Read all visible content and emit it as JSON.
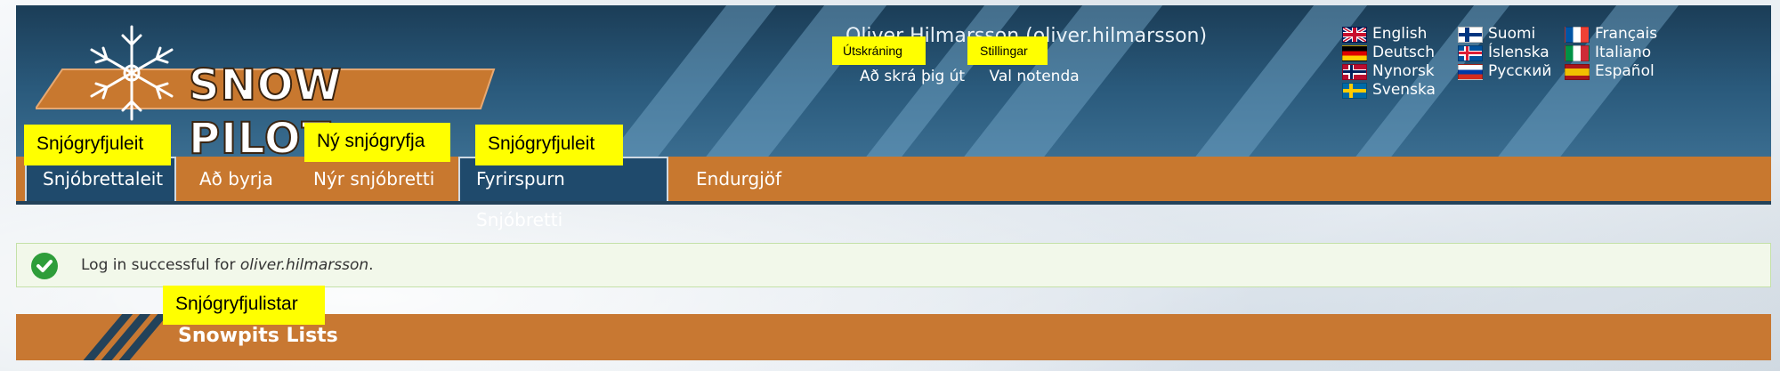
{
  "brand": {
    "logo_text": "SNOW PILOT"
  },
  "user": {
    "display": "Oliver Hilmarsson (oliver.hilmarsson)",
    "logout_label": "Að skrá þig út",
    "preferences_label": "Val notenda",
    "logout_annotation": "Útskráning",
    "preferences_annotation": "Stillingar"
  },
  "languages": [
    {
      "label": "English",
      "flag": "gb-flag-icon"
    },
    {
      "label": "Suomi",
      "flag": "fi-flag-icon"
    },
    {
      "label": "Français",
      "flag": "fr-flag-icon"
    },
    {
      "label": "Deutsch",
      "flag": "de-flag-icon"
    },
    {
      "label": "Íslenska",
      "flag": "is-flag-icon"
    },
    {
      "label": "Italiano",
      "flag": "it-flag-icon"
    },
    {
      "label": "Nynorsk",
      "flag": "no-flag-icon"
    },
    {
      "label": "Русский",
      "flag": "ru-flag-icon"
    },
    {
      "label": "Español",
      "flag": "es-flag-icon"
    },
    {
      "label": "Svenska",
      "flag": "se-flag-icon"
    }
  ],
  "nav": {
    "items": [
      {
        "label": "Snjóbrettaleit",
        "active": true
      },
      {
        "label": "Að byrja",
        "active": false
      },
      {
        "label": "Nýr snjóbretti",
        "active": false
      },
      {
        "label": "Fyrirspurn Snjóbretti",
        "active": true
      },
      {
        "label": "Endurgjöf",
        "active": false
      }
    ],
    "annotations": {
      "search": "Snjógryfjuleit",
      "new": "Ný snjógryfja",
      "query": "Snjógryfjuleit"
    }
  },
  "message": {
    "prefix": "Log in successful for ",
    "username": "oliver.hilmarsson",
    "suffix": "."
  },
  "section": {
    "title": "Snowpits Lists",
    "annotation": "Snjógryfjulistar"
  },
  "colors": {
    "header_dark": "#1b3d57",
    "nav_orange": "#c8782f",
    "active_tab": "#1f4a6c",
    "success_green": "#2e9d3a",
    "annotation_yellow": "#ffff00"
  }
}
